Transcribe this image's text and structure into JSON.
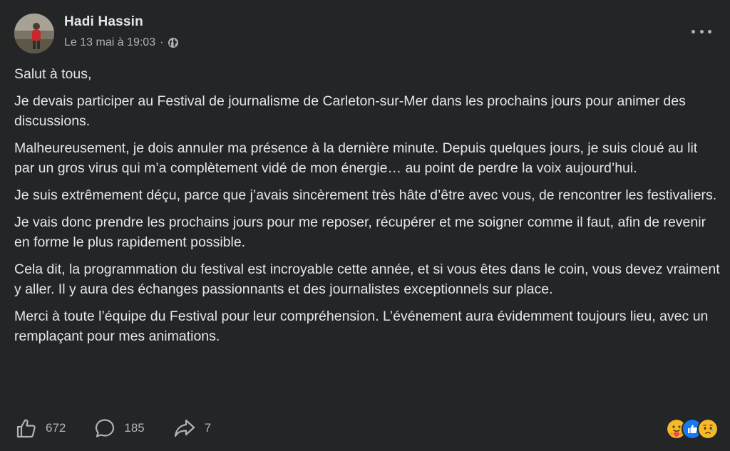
{
  "post": {
    "author": "Hadi Hassin",
    "timestamp": "Le 13 mai à 19:03",
    "separator": "·",
    "privacy_icon": "globe-icon",
    "paragraphs": [
      "Salut à tous,",
      "Je devais participer au Festival de journalisme de Carleton-sur-Mer dans les prochains jours pour animer des discussions.",
      "Malheureusement, je dois annuler ma présence à la dernière minute. Depuis quelques jours, je suis cloué au lit par un gros virus qui m’a complètement vidé de mon énergie… au point de perdre la voix aujourd’hui.",
      "Je suis extrêmement déçu, parce que j’avais sincèrement très hâte d’être avec vous, de rencontrer les festivaliers.",
      "Je vais donc prendre les prochains jours pour me reposer, récupérer et me soigner comme il faut, afin de revenir en forme le plus rapidement possible.",
      "Cela dit, la programmation du festival est incroyable cette année, et si vous êtes dans le coin, vous devez vraiment y aller. Il y aura des échanges passionnants et des journalistes exceptionnels sur place.",
      "Merci à toute l’équipe du Festival pour leur compréhension. L’événement aura évidemment toujours lieu, avec un remplaçant pour mes animations."
    ]
  },
  "actions": {
    "likes": "672",
    "comments": "185",
    "shares": "7"
  },
  "reactions": [
    "care-reaction",
    "like-reaction",
    "sad-reaction"
  ],
  "colors": {
    "background": "#242526",
    "text": "#e4e6eb",
    "secondary": "#b0b3b8",
    "like_blue": "#1877f2",
    "reaction_yellow": "#f7b928"
  }
}
